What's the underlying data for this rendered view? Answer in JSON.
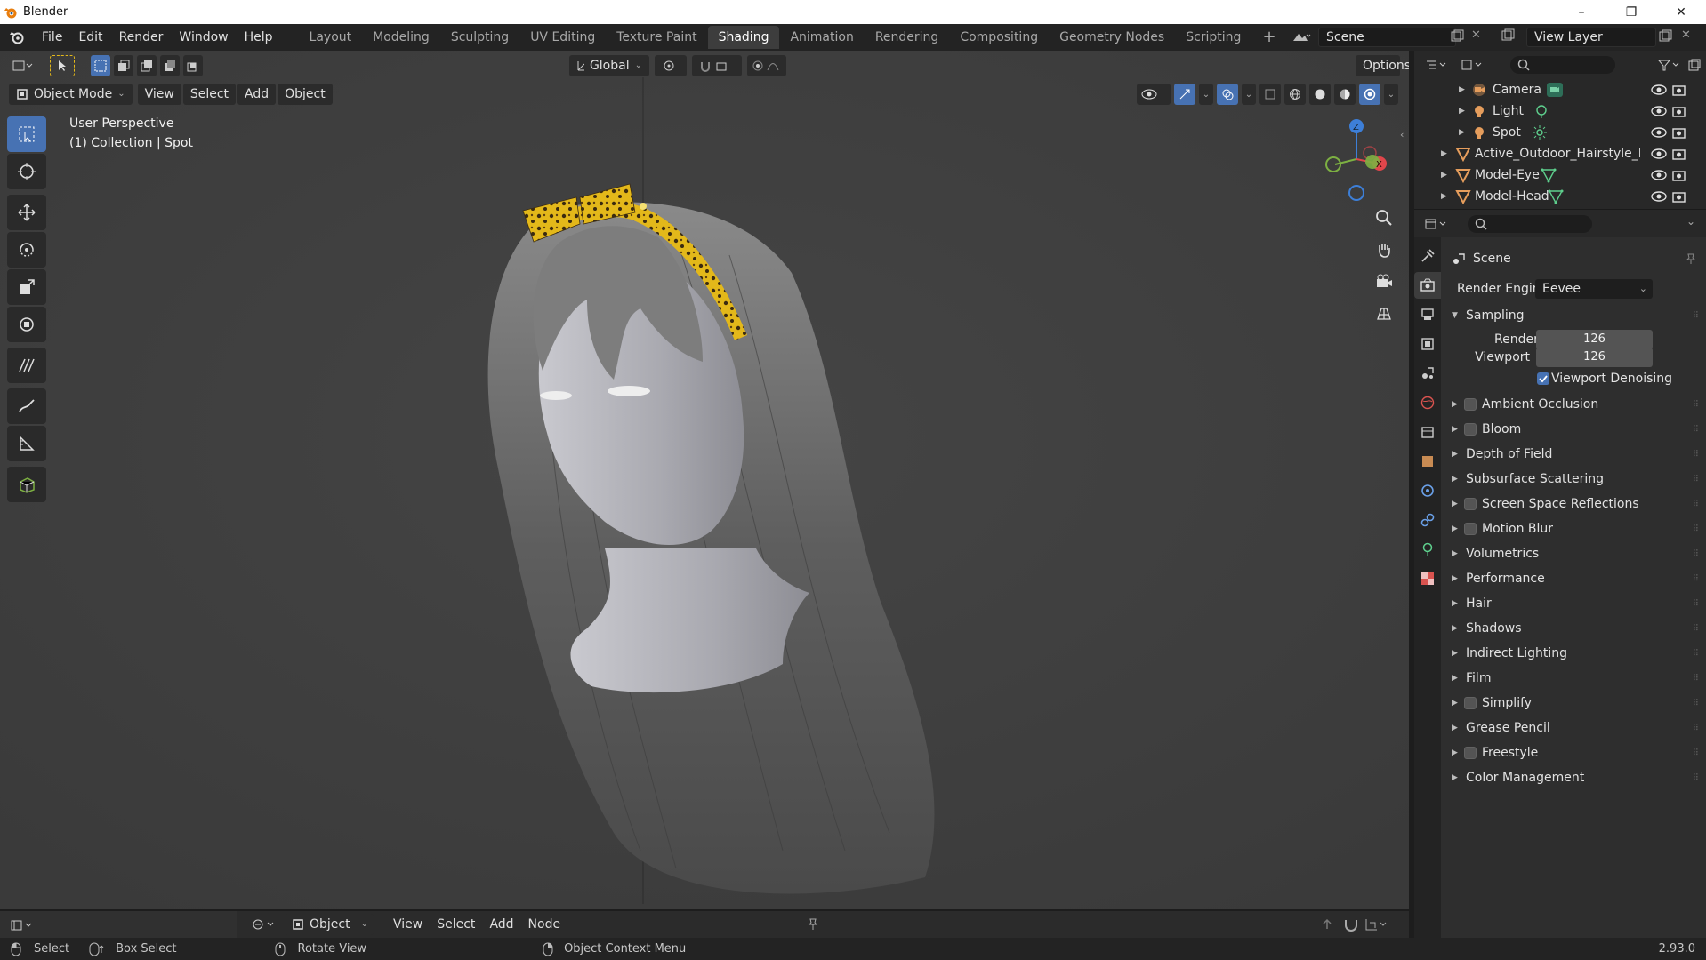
{
  "window": {
    "title": "Blender",
    "min": "–",
    "max": "❐",
    "close": "✕"
  },
  "menu": [
    "File",
    "Edit",
    "Render",
    "Window",
    "Help"
  ],
  "workspaces": [
    "Layout",
    "Modeling",
    "Sculpting",
    "UV Editing",
    "Texture Paint",
    "Shading",
    "Animation",
    "Rendering",
    "Compositing",
    "Geometry Nodes",
    "Scripting"
  ],
  "active_workspace": "Shading",
  "scene_name": "Scene",
  "view_layer": "View Layer",
  "viewport": {
    "transform_orientation": "Global",
    "options_label": "Options",
    "mode": "Object Mode",
    "header_menus": [
      "View",
      "Select",
      "Add",
      "Object"
    ],
    "overlay_line1": "User Perspective",
    "overlay_line2": "(1) Collection | Spot",
    "gizmo_labels": {
      "z": "Z",
      "x": "X"
    }
  },
  "outliner": {
    "items": [
      {
        "label": "Camera",
        "icon": "camera-data-icon"
      },
      {
        "label": "Light",
        "icon": "light-data-icon"
      },
      {
        "label": "Spot",
        "icon": "spot-light-icon"
      },
      {
        "label": "Active_Outdoor_Hairstyle_Lc",
        "icon": "mesh-icon"
      },
      {
        "label": "Model-Eye",
        "icon": "mesh-icon"
      },
      {
        "label": "Model-Head",
        "icon": "mesh-icon"
      }
    ]
  },
  "properties": {
    "context_label": "Scene",
    "render_engine_label": "Render Engine",
    "render_engine_value": "Eevee",
    "sampling_label": "Sampling",
    "render_label": "Render",
    "render_samples": "126",
    "viewport_label": "Viewport",
    "viewport_samples": "126",
    "viewport_denoising_label": "Viewport Denoising",
    "viewport_denoising": true,
    "panels": [
      {
        "label": "Ambient Occlusion",
        "checkbox": true
      },
      {
        "label": "Bloom",
        "checkbox": true
      },
      {
        "label": "Depth of Field",
        "checkbox": false
      },
      {
        "label": "Subsurface Scattering",
        "checkbox": false
      },
      {
        "label": "Screen Space Reflections",
        "checkbox": true
      },
      {
        "label": "Motion Blur",
        "checkbox": true
      },
      {
        "label": "Volumetrics",
        "checkbox": false
      },
      {
        "label": "Performance",
        "checkbox": false
      },
      {
        "label": "Hair",
        "checkbox": false
      },
      {
        "label": "Shadows",
        "checkbox": false
      },
      {
        "label": "Indirect Lighting",
        "checkbox": false
      },
      {
        "label": "Film",
        "checkbox": false
      },
      {
        "label": "Simplify",
        "checkbox": true
      },
      {
        "label": "Grease Pencil",
        "checkbox": false
      },
      {
        "label": "Freestyle",
        "checkbox": true
      },
      {
        "label": "Color Management",
        "checkbox": false
      }
    ]
  },
  "shader_editor": {
    "object_dropdown": "Object",
    "menus": [
      "View",
      "Select",
      "Add",
      "Node"
    ]
  },
  "statusbar": {
    "select": "Select",
    "box_select": "Box Select",
    "rotate_view": "Rotate View",
    "context_menu": "Object Context Menu",
    "version": "2.93.0"
  },
  "colors": {
    "accent": "#4772b3",
    "bandana": "#e3b81a",
    "x_axis": "#e0464b",
    "y_axis": "#7db042",
    "z_axis": "#3d7fd8"
  }
}
